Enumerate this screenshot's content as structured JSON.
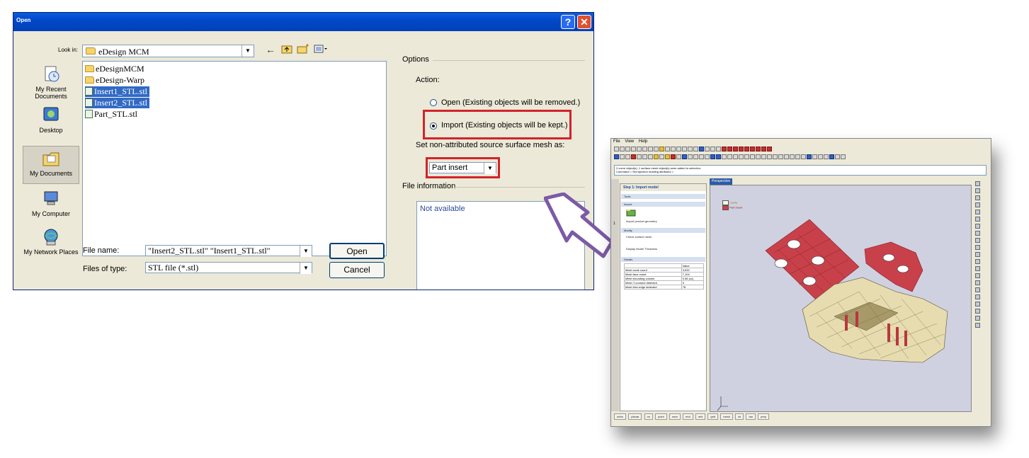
{
  "dialog": {
    "title": "Open",
    "help_label": "?",
    "close_label": "✕",
    "look_in_label": "Look in:",
    "look_in_value": "eDesign MCM",
    "places": [
      {
        "label": "My Recent Documents"
      },
      {
        "label": "Desktop"
      },
      {
        "label": "My Documents"
      },
      {
        "label": "My Computer"
      },
      {
        "label": "My Network Places"
      }
    ],
    "files": [
      {
        "name": "eDesignMCM",
        "type": "folder",
        "selected": false
      },
      {
        "name": "eDesign-Warp",
        "type": "folder",
        "selected": false
      },
      {
        "name": "Insert1_STL.stl",
        "type": "file",
        "selected": true
      },
      {
        "name": "Insert2_STL.stl",
        "type": "file",
        "selected": true
      },
      {
        "name": "Part_STL.stl",
        "type": "file",
        "selected": false
      }
    ],
    "file_name_label": "File name:",
    "file_name_value": "\"Insert2_STL.stl\" \"Insert1_STL.stl\"",
    "files_of_type_label": "Files of type:",
    "files_of_type_value": "STL file (*.stl)",
    "open_button": "Open",
    "cancel_button": "Cancel",
    "options_label": "Options",
    "action_label": "Action:",
    "radio_open": "Open (Existing objects will be removed.)",
    "radio_import": "Import (Existing objects will be kept.)",
    "selected_action": "import",
    "mesh_label": "Set non-attributed source surface mesh as:",
    "mesh_value": "Part insert",
    "file_info_label": "File information",
    "file_info_value": "Not available"
  },
  "app": {
    "menu": [
      "File",
      "View",
      "Help"
    ],
    "command_log": [
      "2 curve object(s), 1 surface mesh object(s) were added to selection.",
      "Command < Set injection molding attributes >"
    ],
    "panel_title": "Step 1: Import model",
    "tools_label": "Tools",
    "import_label": "Import",
    "import_item": "Import product geometry",
    "modify_label": "Modify",
    "check_item": "Check surface mesh",
    "thickness_item": "Display Model Thickness",
    "details_label": "Details",
    "details_header": [
      "",
      "Value"
    ],
    "details_rows": [
      [
        "Mesh node count",
        "3,532"
      ],
      [
        "Mesh face count",
        "7,104"
      ],
      [
        "Mesh bounding volume",
        "0.56 (cc)"
      ],
      [
        "Mesh T-connect detected",
        "0"
      ],
      [
        "Mesh free-edge detected",
        "78"
      ]
    ],
    "viewport_tab": "Perspective",
    "legend": [
      "Cavity",
      "Part insert"
    ],
    "status_items": [
      "ortho",
      "planar",
      "on",
      "point",
      "near",
      "end",
      "mid",
      "grid",
      "mesh",
      "int",
      "tan",
      "perp"
    ]
  },
  "colors": {
    "insert_red": "#c8414a",
    "part_cream": "#e6dcb0",
    "arrow_purple": "#7b5aa6",
    "highlight_red": "#d2232a"
  }
}
